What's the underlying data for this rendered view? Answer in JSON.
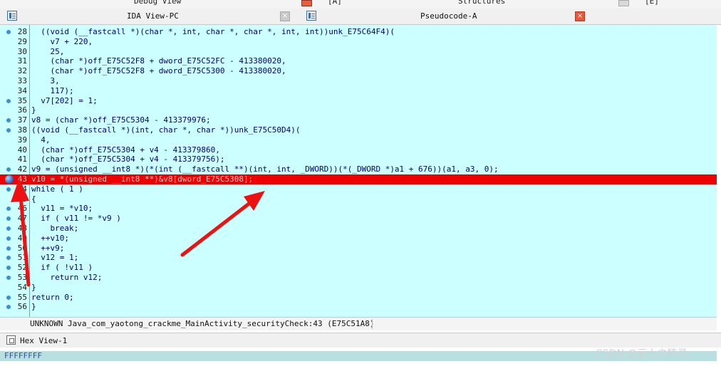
{
  "top_tabs": {
    "left_label": "Debug View",
    "mid_label": "[A]",
    "right_label": "Structures",
    "far_label": "[E]"
  },
  "tabs": [
    {
      "label": "IDA View-PC",
      "active": false
    },
    {
      "label": "Pseudocode-A",
      "active": true
    }
  ],
  "close_glyph": "×",
  "highlight_color": "#ee0000",
  "code_background": "#ccffff",
  "lines": [
    {
      "num": "28",
      "code": "  ((void (__fastcall *)(char *, int, char *, char *, int, int))unk_E75C64F4)(",
      "bp": true
    },
    {
      "num": "29",
      "code": "    v7 + 220,",
      "bp": false
    },
    {
      "num": "30",
      "code": "    25,",
      "bp": false
    },
    {
      "num": "31",
      "code": "    (char *)off_E75C52F8 + dword_E75C52FC - 413380020,",
      "bp": false
    },
    {
      "num": "32",
      "code": "    (char *)off_E75C52F8 + dword_E75C5300 - 413380020,",
      "bp": false
    },
    {
      "num": "33",
      "code": "    3,",
      "bp": false
    },
    {
      "num": "34",
      "code": "    117);",
      "bp": false
    },
    {
      "num": "35",
      "code": "  v7[202] = 1;",
      "bp": true
    },
    {
      "num": "36",
      "code": "}",
      "bp": false
    },
    {
      "num": "37",
      "code": "v8 = (char *)off_E75C5304 - 413379976;",
      "bp": true
    },
    {
      "num": "38",
      "code": "((void (__fastcall *)(int, char *, char *))unk_E75C50D4)(",
      "bp": true
    },
    {
      "num": "39",
      "code": "  4,",
      "bp": false
    },
    {
      "num": "40",
      "code": "  (char *)off_E75C5304 + v4 - 413379860,",
      "bp": false
    },
    {
      "num": "41",
      "code": "  (char *)off_E75C5304 + v4 - 413379756);",
      "bp": false
    },
    {
      "num": "42",
      "code": "v9 = (unsigned __int8 *)(*(int (__fastcall **)(int, int, _DWORD))(*(_DWORD *)a1 + 676))(a1, a3, 0);",
      "bp": true
    },
    {
      "num": "43",
      "code": "v10 = *(unsigned __int8 **)&v8[dword_E75C5308];",
      "bp": true,
      "current": true
    },
    {
      "num": "44",
      "code": "while ( 1 )",
      "bp": true
    },
    {
      "num": "45",
      "code": "{",
      "bp": false
    },
    {
      "num": "46",
      "code": "  v11 = *v10;",
      "bp": true
    },
    {
      "num": "47",
      "code": "  if ( v11 != *v9 )",
      "bp": true
    },
    {
      "num": "48",
      "code": "    break;",
      "bp": true
    },
    {
      "num": "49",
      "code": "  ++v10;",
      "bp": true
    },
    {
      "num": "50",
      "code": "  ++v9;",
      "bp": true
    },
    {
      "num": "51",
      "code": "  v12 = 1;",
      "bp": true
    },
    {
      "num": "52",
      "code": "  if ( !v11 )",
      "bp": true
    },
    {
      "num": "53",
      "code": "    return v12;",
      "bp": true
    },
    {
      "num": "54",
      "code": "}",
      "bp": false
    },
    {
      "num": "55",
      "code": "return 0;",
      "bp": true
    },
    {
      "num": "56",
      "code": "}",
      "bp": true
    }
  ],
  "status_text": "UNKNOWN Java_com_yaotong_crackme_MainActivity_securityCheck:43 (E75C51A8)",
  "hex_view": {
    "title": "Hex View-1",
    "first_row": "FFFFFFFF"
  },
  "watermark": "CSDN @云上之精灵"
}
